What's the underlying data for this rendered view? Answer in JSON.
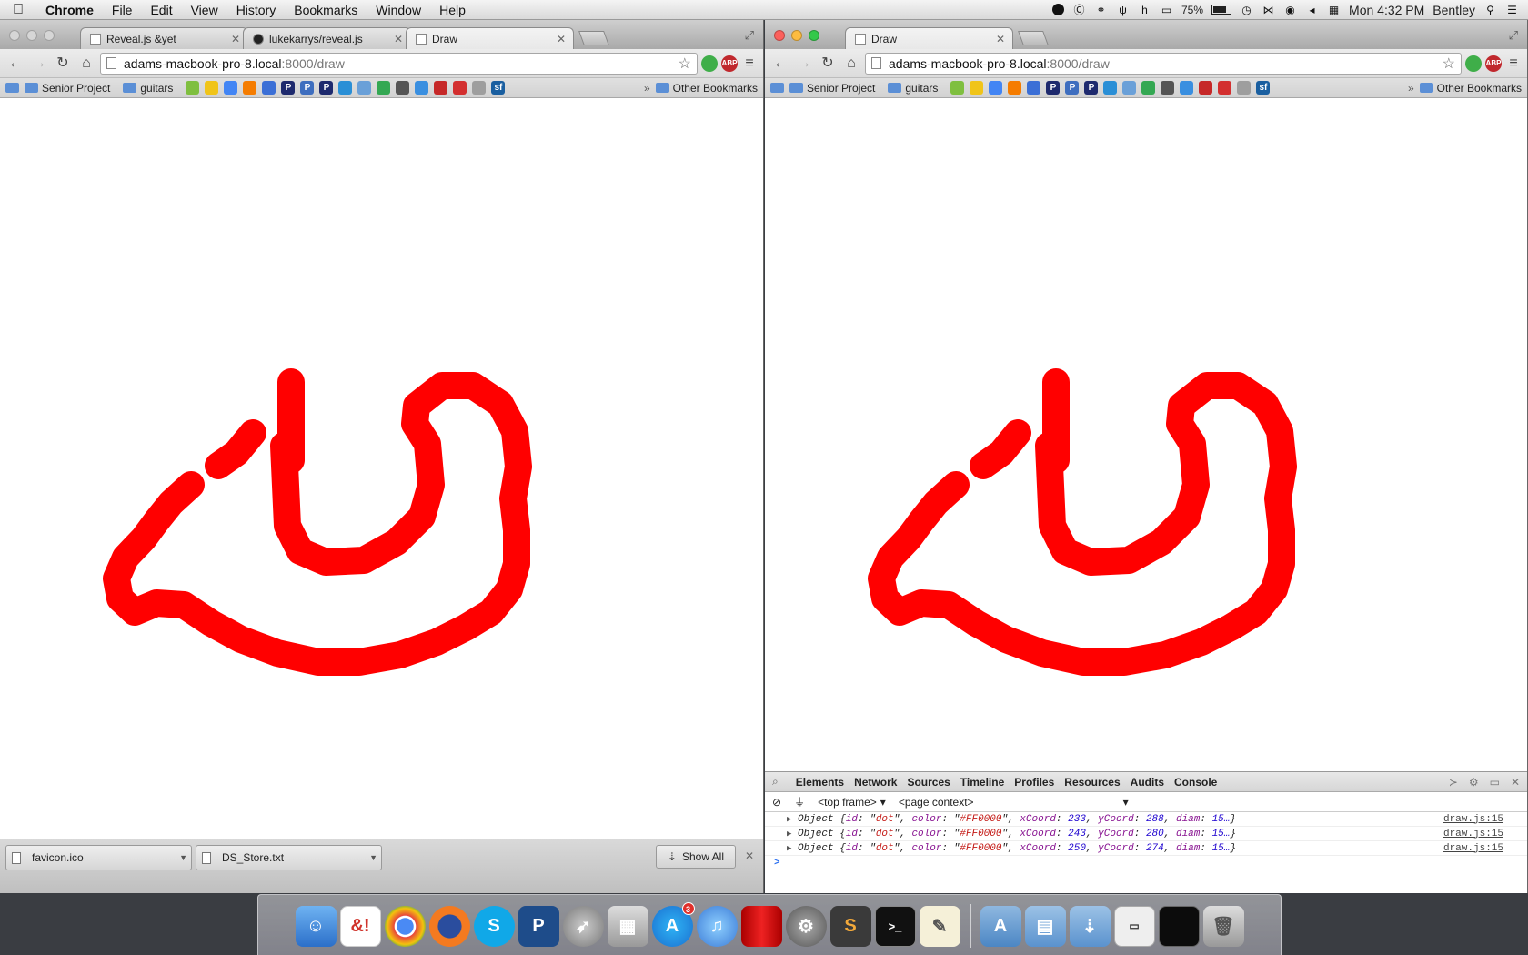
{
  "menubar": {
    "app": "Chrome",
    "items": [
      "File",
      "Edit",
      "View",
      "History",
      "Bookmarks",
      "Window",
      "Help"
    ],
    "battery": "75%",
    "clock": "Mon 4:32 PM",
    "user": "Bentley"
  },
  "left_window": {
    "tabs": [
      {
        "title": "Reveal.js &yet"
      },
      {
        "title": "lukekarrys/reveal.js"
      },
      {
        "title": "Draw"
      }
    ],
    "url_host": "adams-macbook-pro-8.local",
    "url_path": ":8000/draw",
    "downloads": [
      {
        "name": "favicon.ico"
      },
      {
        "name": "DS_Store.txt"
      }
    ],
    "show_all": "Show All"
  },
  "right_window": {
    "tabs": [
      {
        "title": "Draw"
      }
    ],
    "url_host": "adams-macbook-pro-8.local",
    "url_path": ":8000/draw"
  },
  "bookmarks": {
    "folders": [
      "Senior Project",
      "guitars"
    ],
    "other": "Other Bookmarks",
    "more": "»"
  },
  "drawing": {
    "stroke_color": "#FF0000"
  },
  "devtools": {
    "tabs": [
      "Elements",
      "Network",
      "Sources",
      "Timeline",
      "Profiles",
      "Resources",
      "Audits",
      "Console"
    ],
    "frame_select": "<top frame>",
    "context_select": "<page context>",
    "console": [
      {
        "id": "dot",
        "color": "#FF0000",
        "xCoord": "233",
        "yCoord": "288",
        "diam": "15…",
        "source": "draw.js:15"
      },
      {
        "id": "dot",
        "color": "#FF0000",
        "xCoord": "243",
        "yCoord": "280",
        "diam": "15…",
        "source": "draw.js:15"
      },
      {
        "id": "dot",
        "color": "#FF0000",
        "xCoord": "250",
        "yCoord": "274",
        "diam": "15…",
        "source": "draw.js:15"
      }
    ]
  },
  "dock": {
    "badge": "3"
  }
}
